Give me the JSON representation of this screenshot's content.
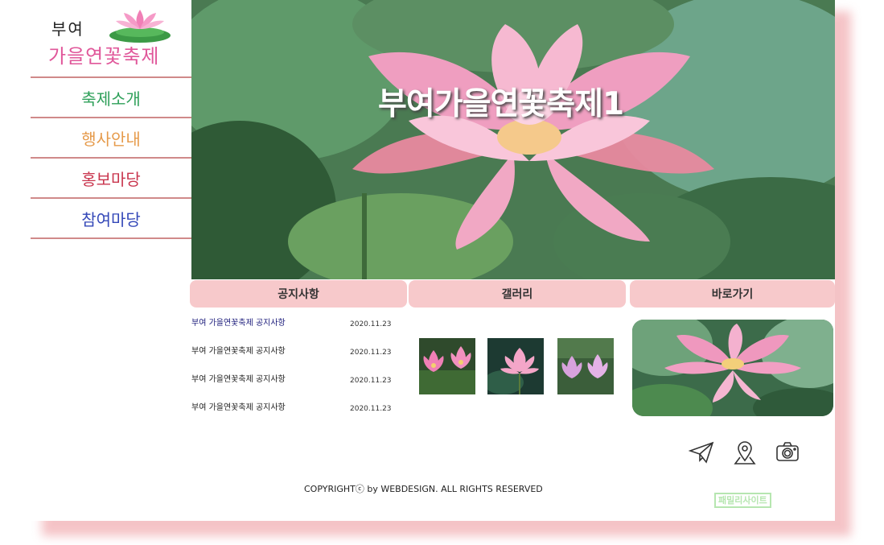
{
  "logo": {
    "line1": "부여",
    "line2": "가을연꽃축제"
  },
  "menu": [
    {
      "label": "축제소개",
      "color": "#2fa05a"
    },
    {
      "label": "행사안내",
      "color": "#e69a4a"
    },
    {
      "label": "홍보마당",
      "color": "#c9364e"
    },
    {
      "label": "참여마당",
      "color": "#3448b8"
    }
  ],
  "hero": {
    "title": "부여가을연꽃축제1"
  },
  "tabs": {
    "notice": "공지사항",
    "gallery": "갤러리",
    "shortcut": "바로가기"
  },
  "notices": [
    {
      "title": "부여 가을연꽃축제 공지사항",
      "date": "2020.11.23"
    },
    {
      "title": "부여 가을연꽃축제 공지사항",
      "date": "2020.11.23"
    },
    {
      "title": "부여 가을연꽃축제 공지사항",
      "date": "2020.11.23"
    },
    {
      "title": "부여 가을연꽃축제 공지사항",
      "date": "2020.11.23"
    }
  ],
  "gallery": [
    {
      "name": "two-pink-lotus"
    },
    {
      "name": "single-pink-lotus"
    },
    {
      "name": "purple-lotus-pair"
    }
  ],
  "icons": [
    "paper-plane-icon",
    "map-pin-icon",
    "camera-icon"
  ],
  "footer": {
    "copyright": "COPYRIGHTⓒ by WEBDESIGN. ALL RIGHTS RESERVED",
    "family": "패밀리사이트"
  },
  "colors": {
    "accent_pink": "#f7c9cb",
    "menu_border": "#d08a8a",
    "family_green": "#b6e6b0"
  }
}
